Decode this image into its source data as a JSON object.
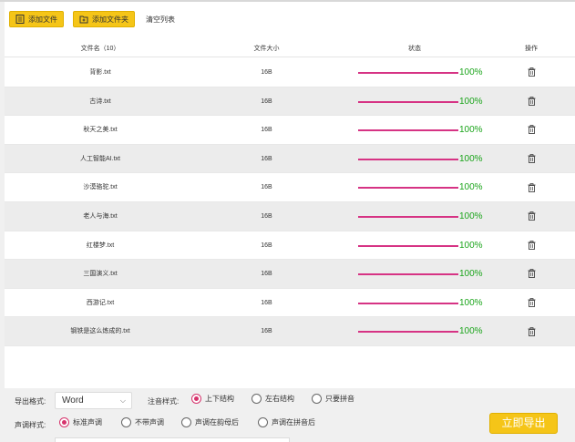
{
  "toolbar": {
    "add_file_label": "添加文件",
    "add_folder_label": "添加文件夹",
    "clear_label": "清空列表"
  },
  "table": {
    "headers": {
      "name": "文件名（10）",
      "size": "文件大小",
      "status": "状态",
      "op": "操作"
    },
    "rows": [
      {
        "name": "背影.txt",
        "size": "16B",
        "progress": 100,
        "status": "100%"
      },
      {
        "name": "古诗.txt",
        "size": "16B",
        "progress": 100,
        "status": "100%"
      },
      {
        "name": "秋天之美.txt",
        "size": "16B",
        "progress": 100,
        "status": "100%"
      },
      {
        "name": "人工智能AI.txt",
        "size": "16B",
        "progress": 100,
        "status": "100%"
      },
      {
        "name": "沙漠骆驼.txt",
        "size": "16B",
        "progress": 100,
        "status": "100%"
      },
      {
        "name": "老人与海.txt",
        "size": "16B",
        "progress": 100,
        "status": "100%"
      },
      {
        "name": "红楼梦.txt",
        "size": "16B",
        "progress": 100,
        "status": "100%"
      },
      {
        "name": "三国演义.txt",
        "size": "16B",
        "progress": 100,
        "status": "100%"
      },
      {
        "name": "西游记.txt",
        "size": "16B",
        "progress": 100,
        "status": "100%"
      },
      {
        "name": "钢铁是这么炼成的.txt",
        "size": "16B",
        "progress": 100,
        "status": "100%"
      }
    ]
  },
  "settings": {
    "export_format_label": "导出格式:",
    "export_format_value": "Word",
    "annotation_label": "注音样式:",
    "annotation_options": [
      "上下结构",
      "左右结构",
      "只要拼音"
    ],
    "annotation_selected": 0,
    "tone_label": "声调样式:",
    "tone_options": [
      "标准声调",
      "不带声调",
      "声调在韵母后",
      "声调在拼音后"
    ],
    "tone_selected": 0,
    "export_button": "立即导出"
  },
  "colors": {
    "accent": "#f5c518",
    "progress": "#d63384",
    "status_text": "#1aa41a",
    "radio_selected": "#d6336c"
  }
}
